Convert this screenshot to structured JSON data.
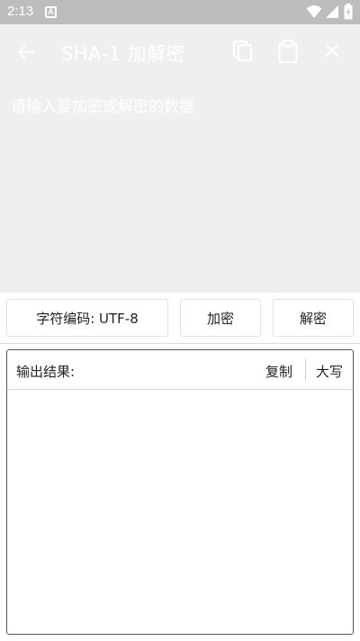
{
  "status_bar": {
    "time": "2:13",
    "notification_badge": "A",
    "icons": [
      "wifi-icon",
      "signal-icon",
      "battery-charging-icon"
    ]
  },
  "app_bar": {
    "title": "SHA-1 加解密",
    "icons": [
      "back-arrow-icon",
      "copy-icon",
      "clipboard-icon",
      "close-icon"
    ]
  },
  "input": {
    "placeholder": "请输入要加密或解密的数据",
    "value": ""
  },
  "controls": {
    "encoding_label": "字符编码: UTF-8",
    "encrypt_label": "加密",
    "decrypt_label": "解密"
  },
  "output": {
    "label": "输出结果:",
    "copy_label": "复制",
    "uppercase_label": "大写",
    "value": ""
  },
  "colors": {
    "status_bar_bg": "#bdbdbd",
    "overlay_bg": "#efefef",
    "border": "#e2e2e2",
    "output_border": "#555555"
  }
}
